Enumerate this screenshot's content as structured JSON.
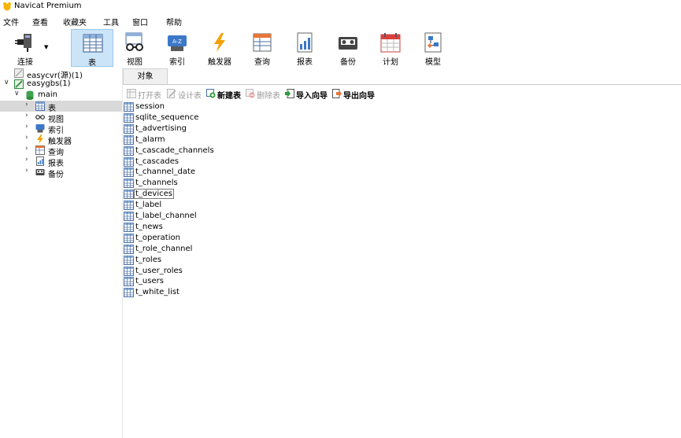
{
  "window": {
    "title": "Navicat Premium"
  },
  "menu": [
    "文件",
    "查看",
    "收藏夹",
    "工具",
    "窗口",
    "帮助"
  ],
  "toolbar": {
    "buttons": [
      {
        "label": "连接",
        "icon": "plug-icon"
      },
      {
        "label": "表",
        "icon": "table-icon"
      },
      {
        "label": "视图",
        "icon": "glasses-icon"
      },
      {
        "label": "索引",
        "icon": "index-icon"
      },
      {
        "label": "触发器",
        "icon": "lightning-icon"
      },
      {
        "label": "查询",
        "icon": "query-icon"
      },
      {
        "label": "报表",
        "icon": "report-icon"
      },
      {
        "label": "备份",
        "icon": "backup-icon"
      },
      {
        "label": "计划",
        "icon": "calendar-icon"
      },
      {
        "label": "模型",
        "icon": "model-icon"
      }
    ],
    "active": "表"
  },
  "sidebar": {
    "connections": [
      {
        "label": "easycvr(源)(1)",
        "expanded": false
      },
      {
        "label": "easygbs(1)",
        "expanded": true
      }
    ],
    "schema": "main",
    "items": [
      {
        "label": "表",
        "icon": "table-icon",
        "selected": true
      },
      {
        "label": "视图",
        "icon": "glasses-icon"
      },
      {
        "label": "索引",
        "icon": "index-icon"
      },
      {
        "label": "触发器",
        "icon": "lightning-icon"
      },
      {
        "label": "查询",
        "icon": "query-icon"
      },
      {
        "label": "报表",
        "icon": "report-icon"
      },
      {
        "label": "备份",
        "icon": "backup-icon"
      }
    ]
  },
  "tabs": {
    "objects": "对象"
  },
  "objectbar": {
    "open": "打开表",
    "design": "设计表",
    "new": "新建表",
    "delete": "删除表",
    "import": "导入向导",
    "export": "导出向导"
  },
  "tables": [
    "session",
    "sqlite_sequence",
    "t_advertising",
    "t_alarm",
    "t_cascade_channels",
    "t_cascades",
    "t_channel_date",
    "t_channels",
    "t_devices",
    "t_label",
    "t_label_channel",
    "t_news",
    "t_operation",
    "t_role_channel",
    "t_roles",
    "t_user_roles",
    "t_users",
    "t_white_list"
  ],
  "focused_table": "t_devices",
  "colors": {
    "accent": "#cce4f7",
    "selection": "#d9d9d9"
  }
}
